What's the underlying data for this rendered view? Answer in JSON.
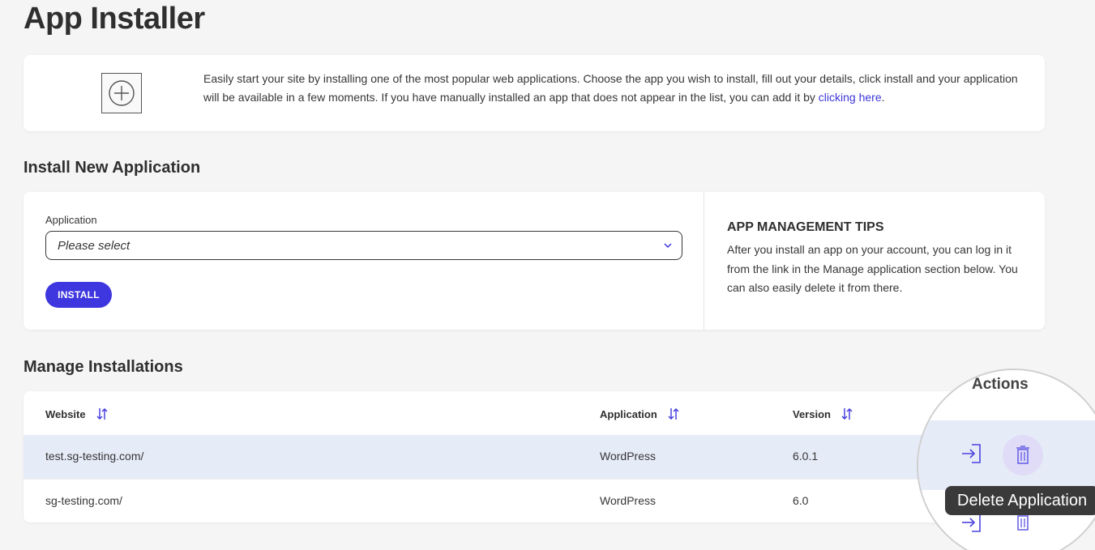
{
  "page": {
    "title": "App Installer"
  },
  "intro": {
    "icon": "plus-circle-icon",
    "text": "Easily start your site by installing one of the most popular web applications. Choose the app you wish to install, fill out your details, click install and your application will be available in a few moments. If you have manually installed an app that does not appear in the list, you can add it by ",
    "link_text": "clicking here",
    "text_end": "."
  },
  "install": {
    "section_title": "Install New Application",
    "field_label": "Application",
    "select_value": "Please select",
    "button_label": "INSTALL",
    "tips_title": "APP MANAGEMENT TIPS",
    "tips_text": "After you install an app on your account, you can log in it from the link in the Manage application section below. You can also easily delete it from there."
  },
  "manage": {
    "section_title": "Manage Installations",
    "columns": [
      "Website",
      "Application",
      "Version",
      "Actions"
    ],
    "rows": [
      {
        "website": "test.sg-testing.com/",
        "application": "WordPress",
        "version": "6.0.1"
      },
      {
        "website": "sg-testing.com/",
        "application": "WordPress",
        "version": "6.0"
      }
    ],
    "tooltip": "Delete Application"
  },
  "colors": {
    "accent": "#3e36de",
    "link": "#3d36d8",
    "highlight_row": "#e6ebf8"
  }
}
